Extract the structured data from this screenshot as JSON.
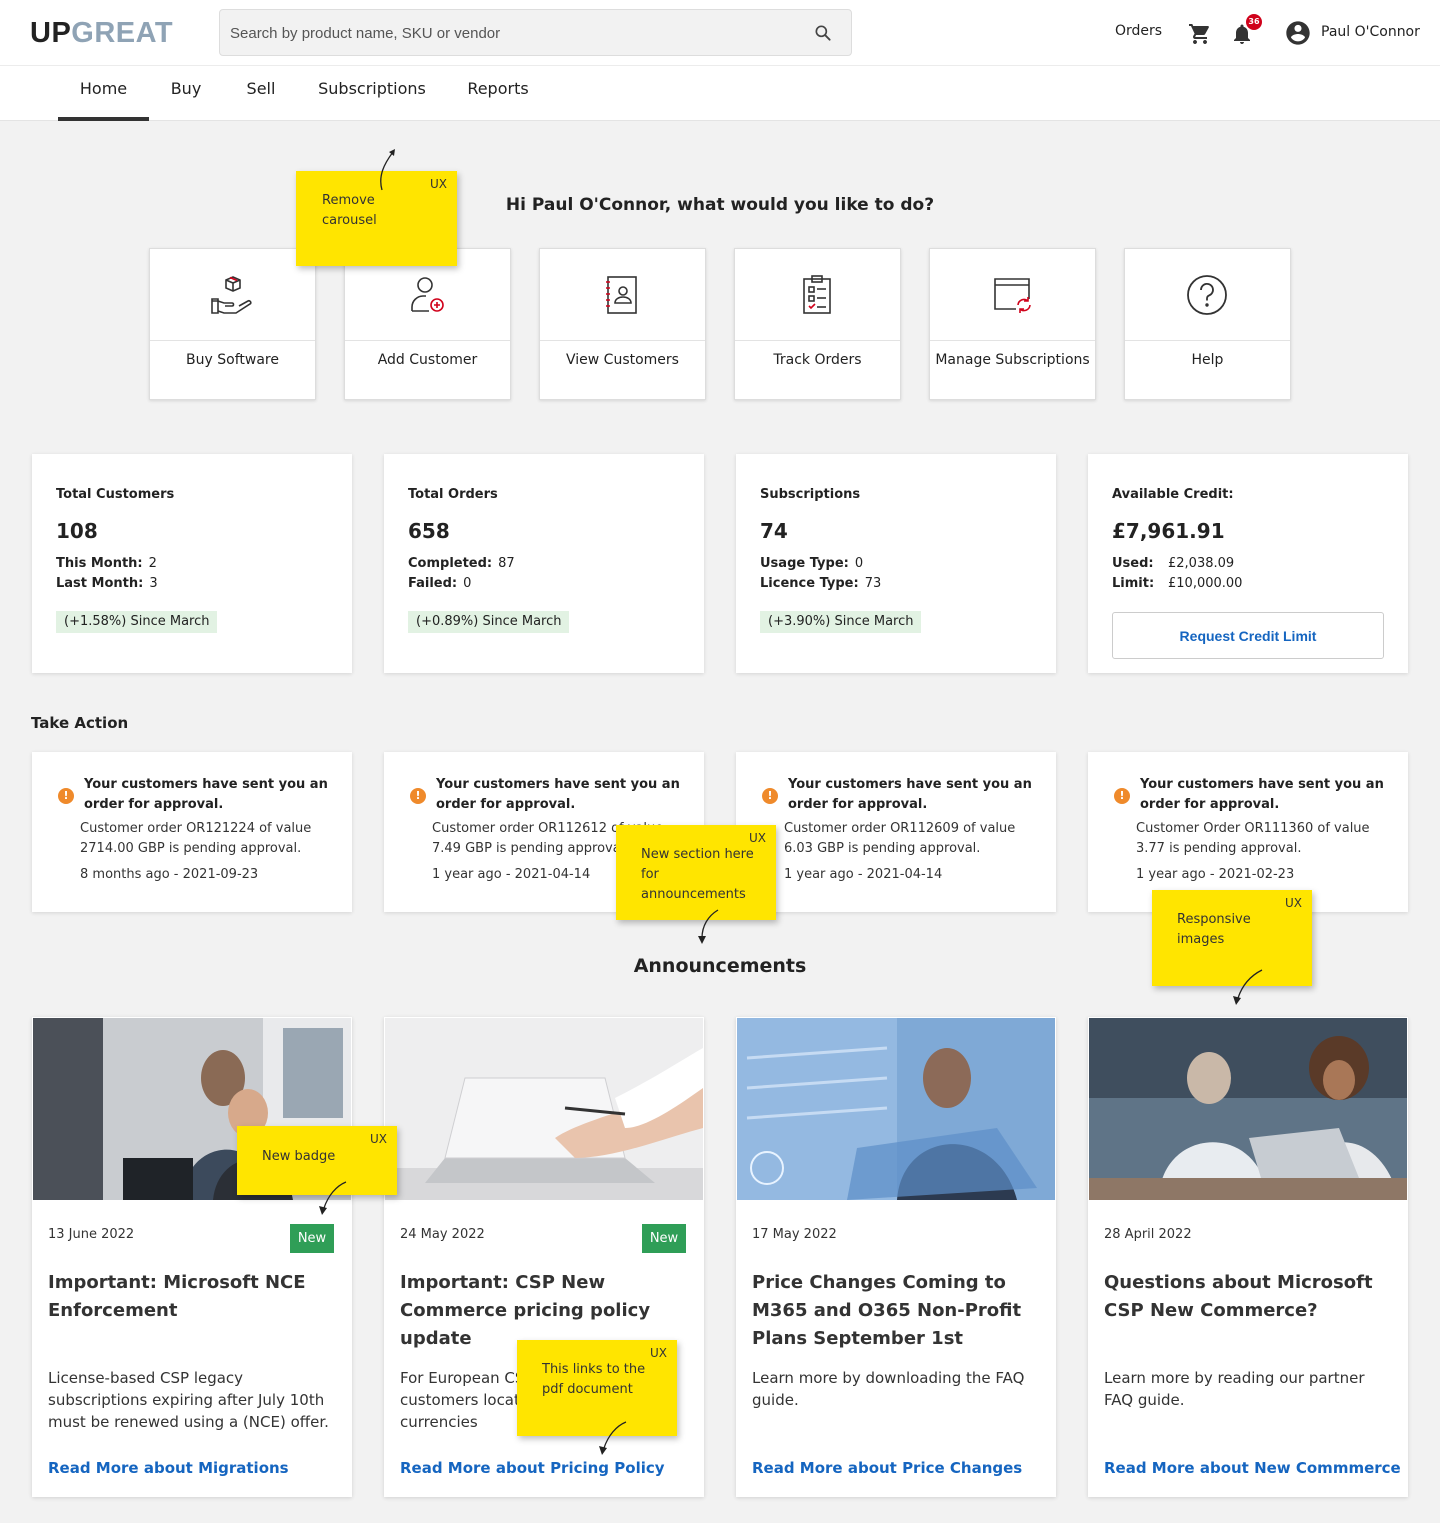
{
  "header": {
    "logo_up": "UP",
    "logo_great": "GREAT",
    "search_placeholder": "Search by product name, SKU or vendor",
    "orders_label": "Orders",
    "notification_count": "36",
    "user_name": "Paul O'Connor"
  },
  "nav": {
    "tabs": [
      {
        "label": "Home",
        "active": true
      },
      {
        "label": "Buy"
      },
      {
        "label": "Sell"
      },
      {
        "label": "Subscriptions"
      },
      {
        "label": "Reports"
      }
    ]
  },
  "greeting": "Hi Paul O'Connor, what would you like to do?",
  "quick_actions": [
    {
      "label": "Buy Software",
      "icon": "box-hand-icon"
    },
    {
      "label": "Add Customer",
      "icon": "add-user-icon"
    },
    {
      "label": "View Customers",
      "icon": "contacts-book-icon"
    },
    {
      "label": "Track Orders",
      "icon": "clipboard-checklist-icon"
    },
    {
      "label": "Manage Subscriptions",
      "icon": "window-refresh-icon"
    },
    {
      "label": "Help",
      "icon": "question-circle-icon"
    }
  ],
  "stats": {
    "customers": {
      "title": "Total Customers",
      "value": "108",
      "row1_label": "This Month:",
      "row1_value": "2",
      "row2_label": "Last Month:",
      "row2_value": "3",
      "change": "(+1.58%) Since March"
    },
    "orders": {
      "title": "Total Orders",
      "value": "658",
      "row1_label": "Completed:",
      "row1_value": "87",
      "row2_label": "Failed:",
      "row2_value": "0",
      "change": "(+0.89%) Since March"
    },
    "subscriptions": {
      "title": "Subscriptions",
      "value": "74",
      "row1_label": "Usage Type:",
      "row1_value": "0",
      "row2_label": "Licence Type:",
      "row2_value": "73",
      "change": "(+3.90%) Since March"
    },
    "credit": {
      "title": "Available Credit:",
      "value": "£7,961.91",
      "row1_label": "Used:",
      "row1_value": "£2,038.09",
      "row2_label": "Limit:",
      "row2_value": "£10,000.00",
      "button": "Request Credit Limit"
    }
  },
  "take_action": {
    "heading": "Take Action",
    "items": [
      {
        "heading": "Your customers have sent you an order for approval.",
        "body": "Customer order OR121224 of value 2714.00 GBP is pending approval.",
        "date": "8 months ago - 2021-09-23"
      },
      {
        "heading": "Your customers have sent you an order for approval.",
        "body": "Customer order OR112612 of value 7.49 GBP is pending approval.",
        "date": "1 year ago - 2021-04-14"
      },
      {
        "heading": "Your customers have sent you an order for approval.",
        "body": "Customer order OR112609 of value 6.03 GBP is pending approval.",
        "date": "1 year ago - 2021-04-14"
      },
      {
        "heading": "Your customers have sent you an order for approval.",
        "body": "Customer Order OR111360 of value 3.77 is pending approval.",
        "date": "1 year ago - 2021-02-23"
      }
    ]
  },
  "announcements": {
    "heading": "Announcements",
    "badge_label": "New",
    "items": [
      {
        "date": "13 June 2022",
        "is_new": true,
        "title": "Important: Microsoft NCE Enforcement",
        "body": "License-based CSP legacy subscriptions expiring after July 10th must be renewed using a (NCE) offer.",
        "link": "Read More about Migrations"
      },
      {
        "date": "24 May 2022",
        "is_new": true,
        "title": "Important: CSP New Commerce pricing policy update",
        "body": "For European CSP partners whose customers located in European currencies",
        "link": "Read More about Pricing Policy"
      },
      {
        "date": "17 May 2022",
        "is_new": false,
        "title": "Price Changes Coming to M365 and O365 Non-Profit Plans September 1st",
        "body": "Learn more by downloading the FAQ guide.",
        "link": "Read More about Price Changes"
      },
      {
        "date": "28 April 2022",
        "is_new": false,
        "title": "Questions about Microsoft CSP New Commerce?",
        "body": "Learn more by reading our partner FAQ guide.",
        "link": "Read More about New Commmerce"
      }
    ]
  },
  "sticky_notes": {
    "tag": "UX",
    "carousel": "Remove carousel",
    "announcements": "New section here for announcements",
    "images": "Responsive images",
    "badge": "New badge",
    "pdf": "This links to the pdf document"
  },
  "colors": {
    "accent": "#1565c0",
    "new_badge": "#2f9e57",
    "warning": "#ef8a2b",
    "sticky": "#ffe500",
    "change_bg": "#e2f2e3"
  }
}
